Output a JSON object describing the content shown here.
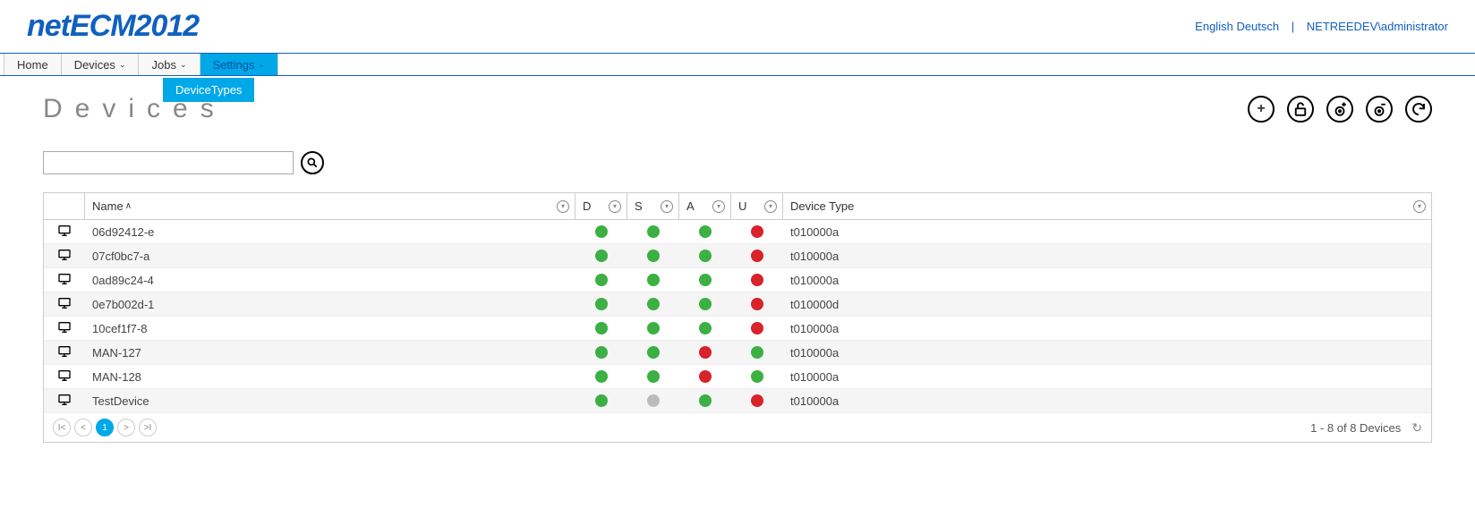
{
  "header": {
    "logo": "netECM2012",
    "lang_en": "English",
    "lang_de": "Deutsch",
    "user": "NETREEDEV\\administrator"
  },
  "nav": {
    "home": "Home",
    "devices": "Devices",
    "jobs": "Jobs",
    "settings": "Settings",
    "dropdown_item": "DeviceTypes"
  },
  "page": {
    "title": "Devices"
  },
  "search": {
    "value": "",
    "placeholder": ""
  },
  "columns": {
    "name": "Name",
    "d": "D",
    "s": "S",
    "a": "A",
    "u": "U",
    "type": "Device Type"
  },
  "rows": [
    {
      "name": "06d92412-e",
      "d": "green",
      "s": "green",
      "a": "green",
      "u": "red",
      "type": "t010000a"
    },
    {
      "name": "07cf0bc7-a",
      "d": "green",
      "s": "green",
      "a": "green",
      "u": "red",
      "type": "t010000a"
    },
    {
      "name": "0ad89c24-4",
      "d": "green",
      "s": "green",
      "a": "green",
      "u": "red",
      "type": "t010000a"
    },
    {
      "name": "0e7b002d-1",
      "d": "green",
      "s": "green",
      "a": "green",
      "u": "red",
      "type": "t010000d"
    },
    {
      "name": "10cef1f7-8",
      "d": "green",
      "s": "green",
      "a": "green",
      "u": "red",
      "type": "t010000a"
    },
    {
      "name": "MAN-127",
      "d": "green",
      "s": "green",
      "a": "red",
      "u": "green",
      "type": "t010000a"
    },
    {
      "name": "MAN-128",
      "d": "green",
      "s": "green",
      "a": "red",
      "u": "green",
      "type": "t010000a"
    },
    {
      "name": "TestDevice",
      "d": "green",
      "s": "gray",
      "a": "green",
      "u": "red",
      "type": "t010000a"
    }
  ],
  "pager": {
    "current": "1",
    "status": "1 - 8 of 8 Devices"
  }
}
